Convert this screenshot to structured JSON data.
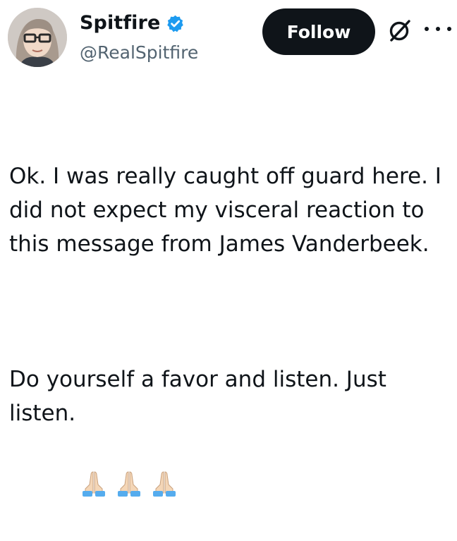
{
  "author": {
    "display_name": "Spitfire",
    "handle": "@RealSpitfire",
    "verified": true,
    "avatar_icon": "avatar"
  },
  "actions": {
    "follow_label": "Follow",
    "grok_icon": "grok-icon",
    "more_icon": "more-icon"
  },
  "tweet": {
    "paragraph1": "Ok. I was really caught off guard here. I did not expect my visceral reaction to this message from James Vanderbeek.",
    "paragraph2": "Do yourself a favor and listen. Just listen.",
    "emoji": [
      "folded-hands",
      "folded-hands",
      "folded-hands"
    ]
  },
  "colors": {
    "text": "#0f1419",
    "secondary_text": "#536471",
    "verified_badge": "#1d9bf0",
    "follow_button_bg": "#0f1419"
  }
}
